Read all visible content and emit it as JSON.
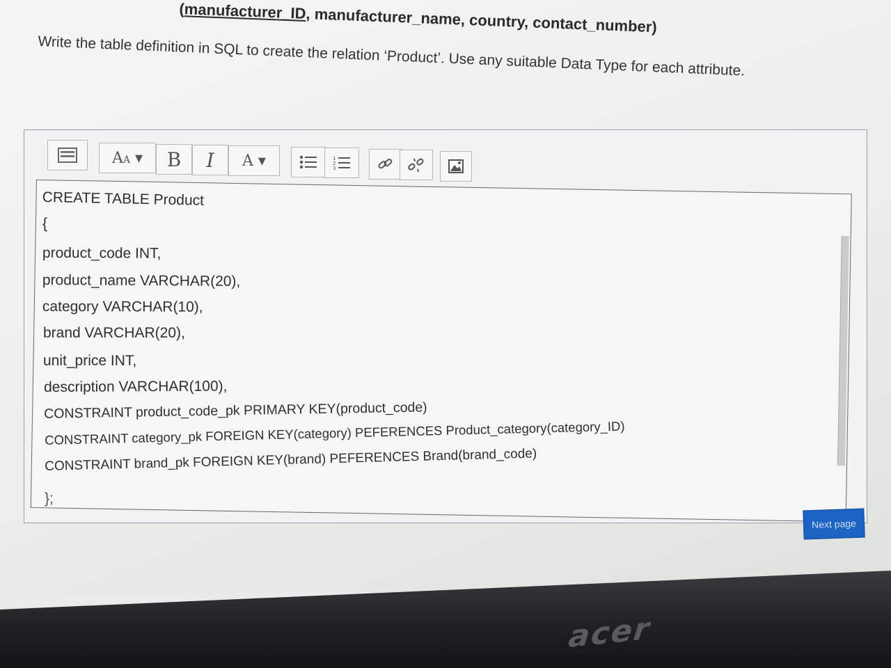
{
  "question": {
    "header_underlined": "manufacturer_ID",
    "header_rest": ", manufacturer_name, country, contact_number)",
    "header_prefix": "(",
    "instruction": "Write the table definition in SQL to create the relation ‘Product’. Use any suitable Data Type for each attribute."
  },
  "toolbar": {
    "font_size_label": "A",
    "bold_label": "B",
    "italic_label": "I",
    "text_color_label": "A",
    "icons": [
      "toggle-toolbar-icon",
      "font-size-icon",
      "bold-icon",
      "italic-icon",
      "text-color-icon",
      "bullet-list-icon",
      "numbered-list-icon",
      "link-icon",
      "unlink-icon",
      "image-icon"
    ]
  },
  "answer": {
    "lines": [
      "CREATE TABLE Product",
      "{",
      "product_code INT,",
      "product_name VARCHAR(20),",
      "category VARCHAR(10),",
      "brand VARCHAR(20),",
      "unit_price INT,",
      "description VARCHAR(100),",
      "CONSTRAINT product_code_pk PRIMARY KEY(product_code)",
      "CONSTRAINT category_pk FOREIGN KEY(category) PEFERENCES Product_category(category_ID)",
      "CONSTRAINT brand_pk FOREIGN KEY(brand) PEFERENCES Brand(brand_code)",
      "};"
    ]
  },
  "navigation": {
    "next_label": "Next page"
  },
  "device": {
    "brand_logo": "acer"
  },
  "colors": {
    "next_button": "#1c63c4",
    "text": "#2f2f2f"
  }
}
